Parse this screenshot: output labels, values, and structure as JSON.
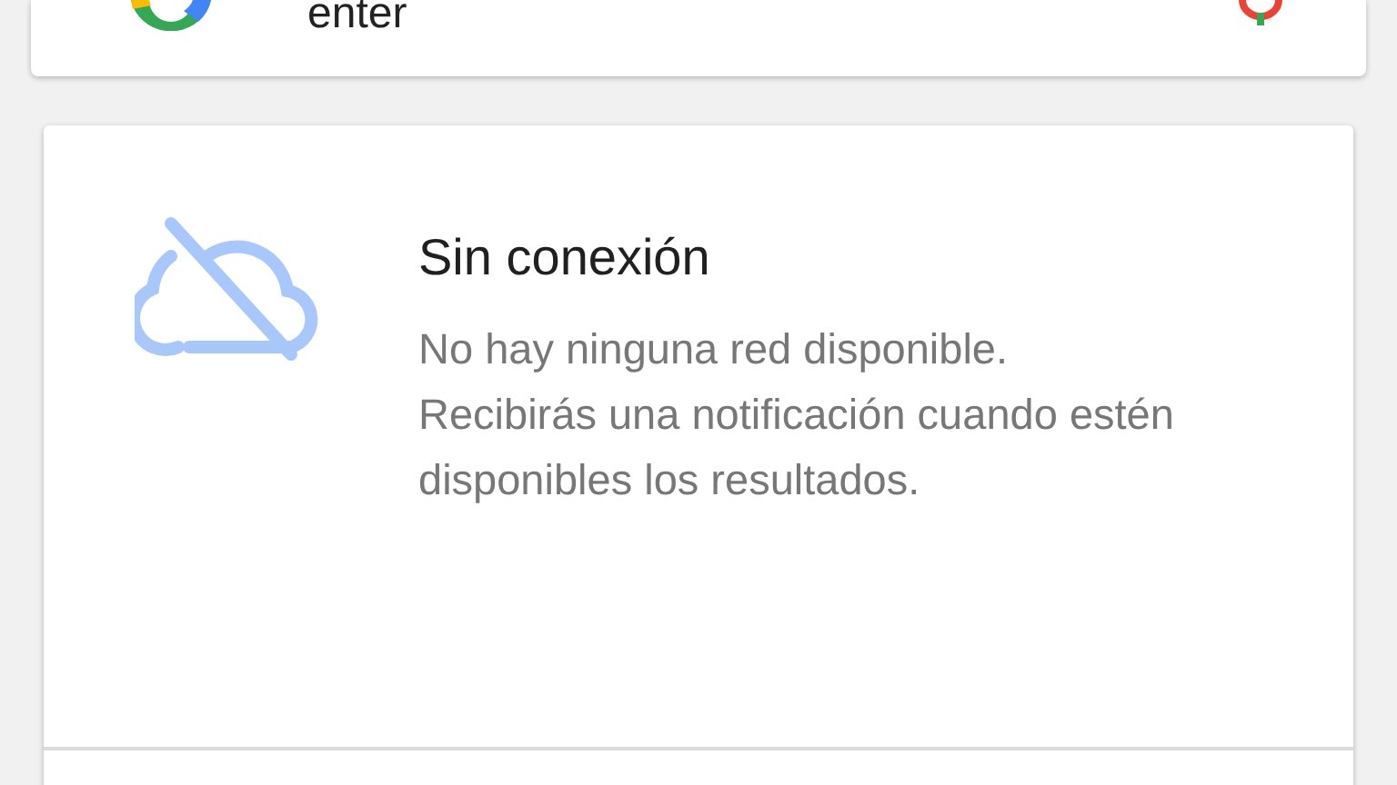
{
  "search": {
    "value": "enter"
  },
  "offline_card": {
    "title": "Sin conexión",
    "message": "No hay ninguna red disponible. Recibirás una notificación cuando estén disponibles los resultados."
  }
}
